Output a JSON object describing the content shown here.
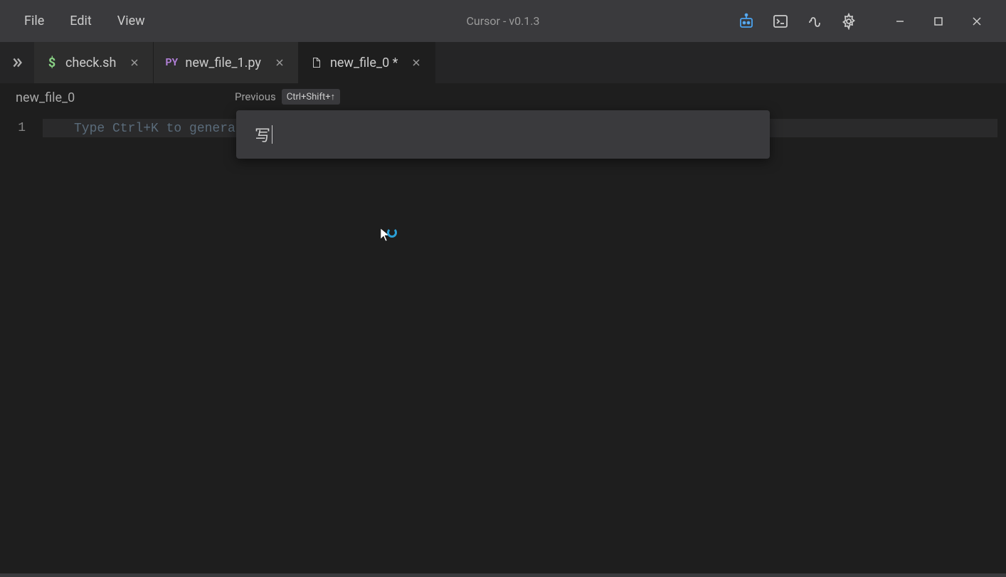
{
  "titlebar": {
    "menu": [
      "File",
      "Edit",
      "View"
    ],
    "title": "Cursor - v0.1.3"
  },
  "tabs": [
    {
      "icon": "dollar",
      "label": "check.sh",
      "active": false
    },
    {
      "icon": "py",
      "label": "new_file_1.py",
      "active": false
    },
    {
      "icon": "file",
      "label": "new_file_0 *",
      "active": true
    }
  ],
  "breadcrumb": "new_file_0",
  "prompt": {
    "header_label": "Previous",
    "header_shortcut": "Ctrl+Shift+↑",
    "input_value": "写"
  },
  "editor": {
    "lines": [
      {
        "number": "1",
        "placeholder": "Type Ctrl+K to generat"
      }
    ]
  }
}
